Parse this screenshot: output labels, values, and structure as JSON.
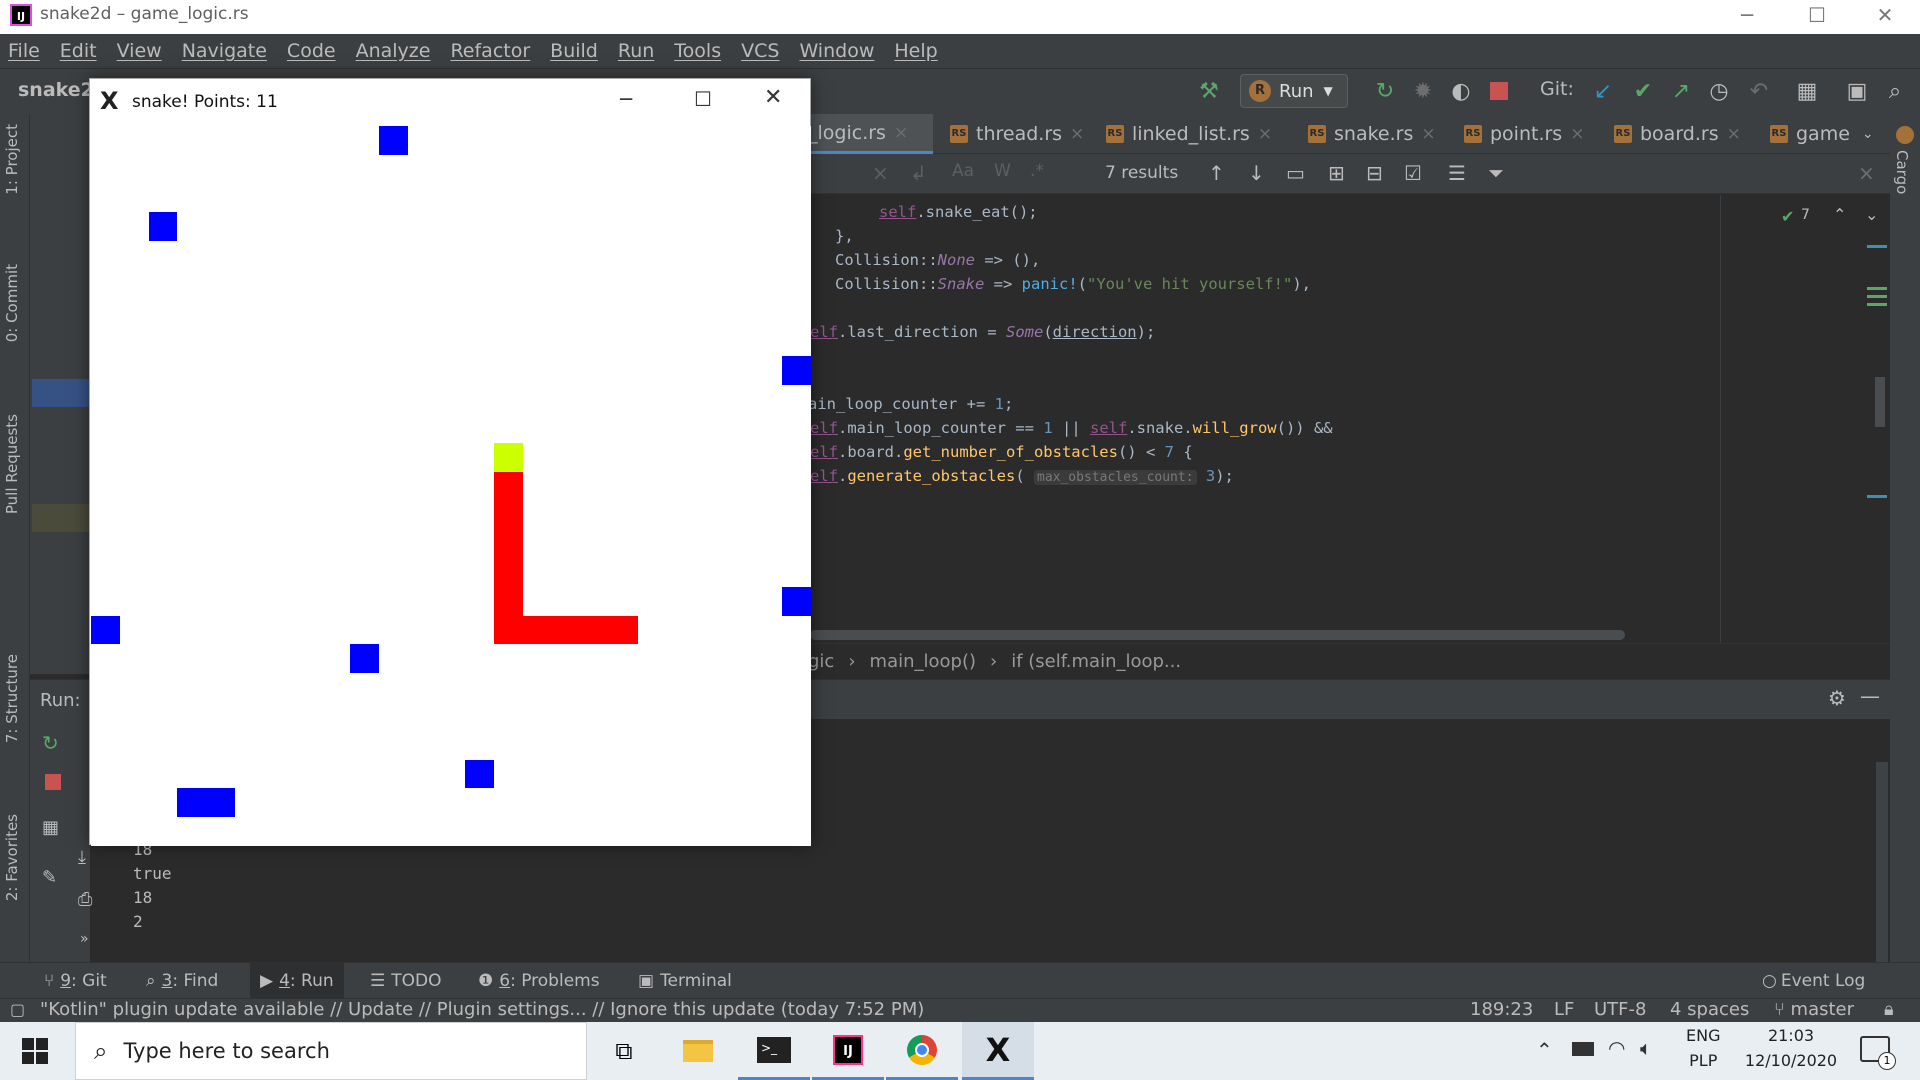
{
  "window": {
    "title": "snake2d – game_logic.rs",
    "app_icon": "IJ"
  },
  "menu": [
    "File",
    "Edit",
    "View",
    "Navigate",
    "Code",
    "Analyze",
    "Refactor",
    "Build",
    "Run",
    "Tools",
    "VCS",
    "Window",
    "Help"
  ],
  "toolbar": {
    "project_name": "snake2",
    "run_config": "Run",
    "git_label": "Git:"
  },
  "left_tabs": [
    "1: Project",
    "0: Commit",
    "Pull Requests",
    "7: Structure",
    "2: Favorites"
  ],
  "right_tabs": [
    "Cargo"
  ],
  "tabs": [
    {
      "label": "_logic.rs",
      "active": true
    },
    {
      "label": "thread.rs",
      "active": false
    },
    {
      "label": "linked_list.rs",
      "active": false
    },
    {
      "label": "snake.rs",
      "active": false
    },
    {
      "label": "point.rs",
      "active": false
    },
    {
      "label": "board.rs",
      "active": false
    },
    {
      "label": "game",
      "active": false
    }
  ],
  "findbar": {
    "results": "7 results",
    "match_case": "Aa",
    "words": "W",
    "regex": ".*"
  },
  "inspection": {
    "count": "7"
  },
  "code": {
    "l1a": "self",
    "l1b": ".snake_eat();",
    "l2": "},",
    "l3a": "Collision::",
    "l3b": "None",
    "l3c": " => (),",
    "l4a": "Collision::",
    "l4b": "Snake",
    "l4c": " => ",
    "l4d": "panic!",
    "l4e": "(",
    "l4f": "\"You've hit yourself!\"",
    "l4g": "),",
    "l5a": "elf",
    "l5b": ".last_direction = ",
    "l5c": "Some",
    "l5d": "(",
    "l5e": "direction",
    "l5f": ");",
    "l6a": "ain_loop_counter += ",
    "l6b": "1",
    "l6c": ";",
    "l7a": "elf",
    "l7b": ".main_loop_counter == ",
    "l7c": "1",
    "l7d": " || ",
    "l7e": "self",
    "l7f": ".snake.",
    "l7g": "will_grow",
    "l7h": "()) &&",
    "l8a": "elf",
    "l8b": ".board.",
    "l8c": "get_number_of_obstacles",
    "l8d": "() < ",
    "l8e": "7",
    "l8f": " {",
    "l9a": "elf",
    "l9b": ".",
    "l9c": "generate_obstacles",
    "l9d": "( ",
    "l9e": "max_obstacles_count:",
    "l9f": " 3",
    "l9g": ");"
  },
  "breadcrumbs": [
    "gic",
    "main_loop()",
    "if (self.main_loop..."
  ],
  "run_panel": {
    "label": "Run:",
    "output": [
      "18",
      "true",
      "18",
      "2"
    ]
  },
  "bottom_tabs": [
    {
      "num": "9",
      "label": ": Git"
    },
    {
      "num": "3",
      "label": ": Find"
    },
    {
      "num": "4",
      "label": ": Run"
    },
    {
      "num": "",
      "label": "TODO"
    },
    {
      "num": "6",
      "label": ": Problems"
    },
    {
      "num": "",
      "label": "Terminal"
    }
  ],
  "event_log": "Event Log",
  "status": {
    "message": "\"Kotlin\" plugin update available // Update // Plugin settings... // Ignore this update (today 7:52 PM)",
    "position": "189:23",
    "line_sep": "LF",
    "encoding": "UTF-8",
    "indent": "4 spaces",
    "branch": "master"
  },
  "taskbar": {
    "search_placeholder": "Type here to search",
    "lang1": "ENG",
    "lang2": "PLP",
    "time": "21:03",
    "date": "12/10/2020",
    "notif_count": "1"
  },
  "snake_window": {
    "title": "snake! Points: 11",
    "grid": 25,
    "snake_head_color": "#ccff00",
    "snake_body_color": "#ff0000",
    "obstacle_color": "#0000ff",
    "snake_head": [
      14,
      11
    ],
    "snake_body": [
      [
        14,
        12
      ],
      [
        14,
        13
      ],
      [
        14,
        14
      ],
      [
        14,
        15
      ],
      [
        14,
        16
      ],
      [
        14,
        17
      ],
      [
        15,
        17
      ],
      [
        16,
        17
      ],
      [
        17,
        17
      ],
      [
        18,
        17
      ]
    ],
    "obstacles": [
      [
        10,
        0
      ],
      [
        2,
        3
      ],
      [
        24,
        8
      ],
      [
        24,
        16
      ],
      [
        0,
        17
      ],
      [
        9,
        18
      ],
      [
        13,
        22
      ],
      [
        3,
        23
      ],
      [
        4,
        23
      ]
    ]
  }
}
